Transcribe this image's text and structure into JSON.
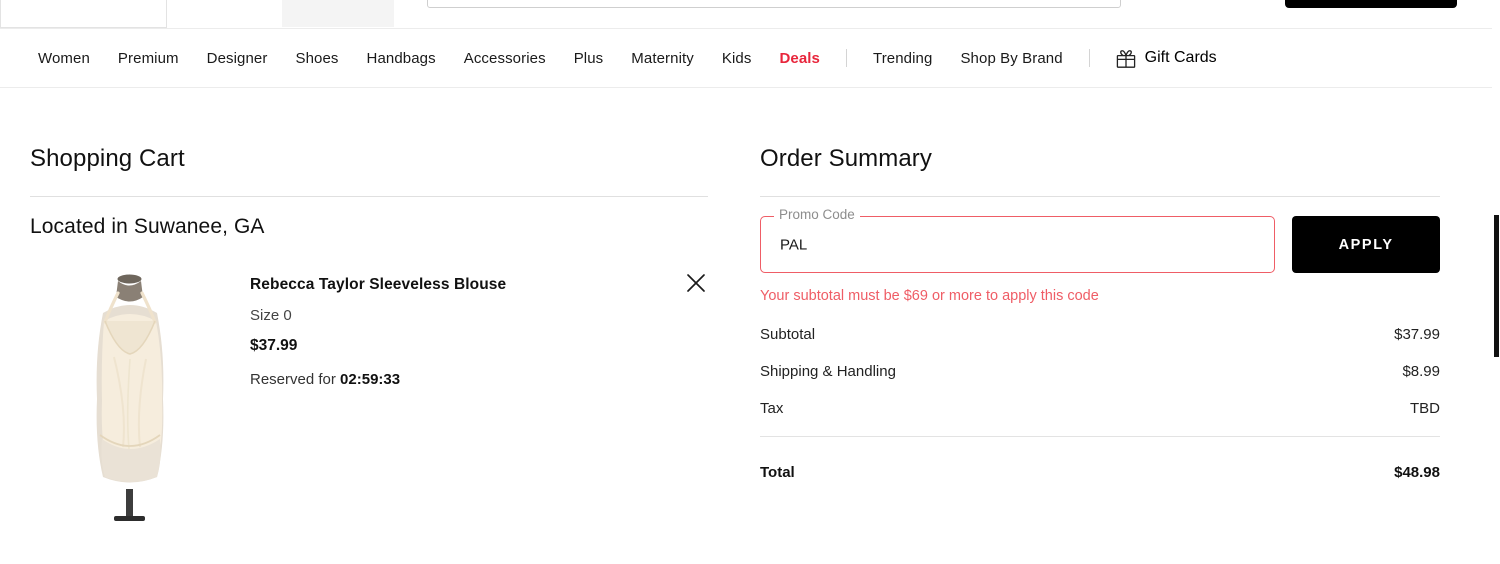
{
  "header": {
    "left_box": "account-box",
    "gray_box": "category-box",
    "search_placeholder": "",
    "cta_button_label": ""
  },
  "nav": {
    "items": [
      {
        "label": "Women",
        "highlight": false
      },
      {
        "label": "Premium",
        "highlight": false
      },
      {
        "label": "Designer",
        "highlight": false
      },
      {
        "label": "Shoes",
        "highlight": false
      },
      {
        "label": "Handbags",
        "highlight": false
      },
      {
        "label": "Accessories",
        "highlight": false
      },
      {
        "label": "Plus",
        "highlight": false
      },
      {
        "label": "Maternity",
        "highlight": false
      },
      {
        "label": "Kids",
        "highlight": false
      },
      {
        "label": "Deals",
        "highlight": true
      },
      {
        "label": "Trending",
        "highlight": false
      },
      {
        "label": "Shop By Brand",
        "highlight": false
      }
    ],
    "gift_cards_label": "Gift Cards",
    "deals_color": "#e8263c"
  },
  "cart": {
    "title": "Shopping Cart",
    "location_label": "Located in Suwanee, GA",
    "item": {
      "title": "Rebecca Taylor Sleeveless Blouse",
      "size": "Size 0",
      "price": "$37.99",
      "reserved_prefix": "Reserved for ",
      "reserved_time": "02:59:33",
      "image_alt": "cream sleeveless camisole blouse on mannequin",
      "remove_label": "×"
    }
  },
  "summary": {
    "title": "Order Summary",
    "promo": {
      "legend": "Promo Code",
      "value": "PAL",
      "placeholder": "Promo Code",
      "apply_label": "APPLY",
      "error": "Your subtotal must be $69 or more to apply this code",
      "error_color": "#ef5d66",
      "border_color": "#ef5d66"
    },
    "lines": [
      {
        "label": "Subtotal",
        "value": "$37.99"
      },
      {
        "label": "Shipping & Handling",
        "value": "$8.99"
      },
      {
        "label": "Tax",
        "value": "TBD"
      }
    ],
    "total": {
      "label": "Total",
      "value": "$48.98"
    }
  }
}
